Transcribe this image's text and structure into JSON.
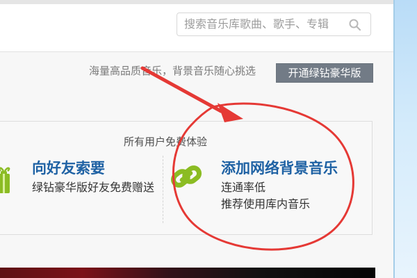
{
  "search": {
    "placeholder": "搜索音乐库歌曲、歌手、专辑",
    "icon": "search-icon"
  },
  "promo": {
    "text": "海量高品质音乐，背景音乐随心挑选",
    "button_label": "开通绿钻豪华版"
  },
  "experience": {
    "title": "所有用户免费体验",
    "friend": {
      "title": "向好友索要",
      "description": "绿钻豪华版好友免费赠送",
      "icon": "gift-icon",
      "color": "#8bbc23"
    },
    "network": {
      "title": "添加网络背景音乐",
      "description_lines": [
        "连通率低",
        "推荐使用库内音乐"
      ],
      "icon": "link-icon",
      "color": "#8bbc23"
    }
  },
  "annotation": {
    "arrow_icon": "red-arrow-icon",
    "circle_icon": "red-circle-annotation",
    "color": "#e53935"
  },
  "colors": {
    "link_blue": "#1f62a4",
    "button_gray": "#727b86"
  }
}
